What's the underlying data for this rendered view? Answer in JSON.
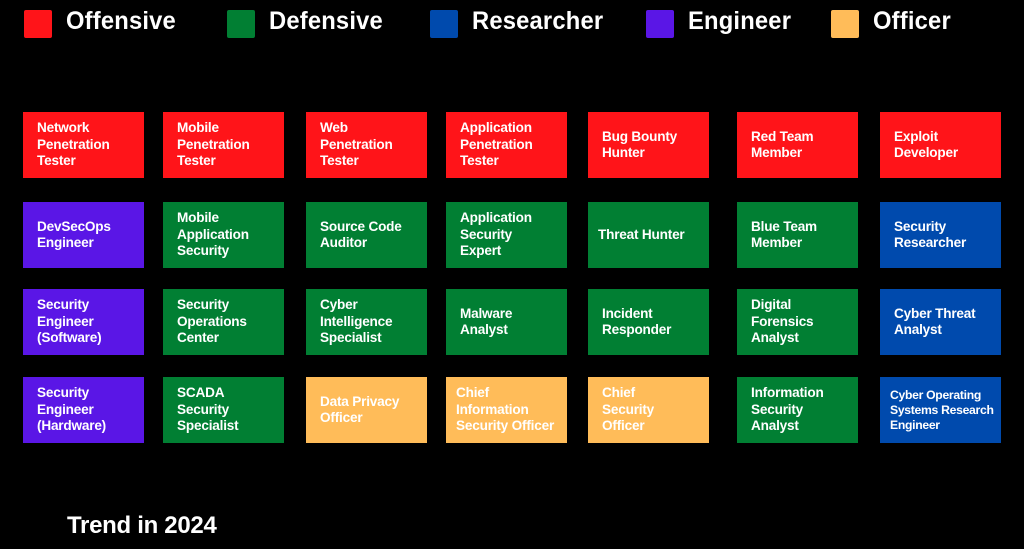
{
  "legend": [
    {
      "label": "Offensive",
      "color": "#ff1419"
    },
    {
      "label": "Defensive",
      "color": "#017f33"
    },
    {
      "label": "Researcher",
      "color": "#004aad"
    },
    {
      "label": "Engineer",
      "color": "#5a16e6"
    },
    {
      "label": "Officer",
      "color": "#ffbc59"
    }
  ],
  "colors": {
    "Offensive": "#ff1419",
    "Defensive": "#017f33",
    "Researcher": "#004aad",
    "Engineer": "#5a16e6",
    "Officer": "#ffbc59"
  },
  "rows": [
    [
      {
        "label": "Network\nPenetration\nTester",
        "category": "Offensive"
      },
      {
        "label": "Mobile\nPenetration\nTester",
        "category": "Offensive"
      },
      {
        "label": "Web\nPenetration\nTester",
        "category": "Offensive"
      },
      {
        "label": "Application\nPenetration\nTester",
        "category": "Offensive"
      },
      {
        "label": "Bug  Bounty\nHunter",
        "category": "Offensive"
      },
      {
        "label": "Red Team\nMember",
        "category": "Offensive"
      },
      {
        "label": "Exploit\nDeveloper",
        "category": "Offensive"
      }
    ],
    [
      {
        "label": "DevSecOps\nEngineer",
        "category": "Engineer"
      },
      {
        "label": "Mobile\nApplication\nSecurity",
        "category": "Defensive"
      },
      {
        "label": "Source Code\nAuditor",
        "category": "Defensive"
      },
      {
        "label": "Application\nSecurity\nExpert",
        "category": "Defensive"
      },
      {
        "label": "Threat Hunter",
        "category": "Defensive"
      },
      {
        "label": "Blue Team\nMember",
        "category": "Defensive"
      },
      {
        "label": "Security\nResearcher",
        "category": "Researcher"
      }
    ],
    [
      {
        "label": "Security\nEngineer\n(Software)",
        "category": "Engineer"
      },
      {
        "label": "Security\nOperations\nCenter",
        "category": "Defensive"
      },
      {
        "label": "Cyber\nIntelligence\nSpecialist",
        "category": "Defensive"
      },
      {
        "label": "Malware\nAnalyst",
        "category": "Defensive"
      },
      {
        "label": "Incident\nResponder",
        "category": "Defensive"
      },
      {
        "label": "Digital\nForensics\nAnalyst",
        "category": "Defensive"
      },
      {
        "label": "Cyber Threat\nAnalyst",
        "category": "Researcher"
      }
    ],
    [
      {
        "label": "Security\nEngineer\n(Hardware)",
        "category": "Engineer"
      },
      {
        "label": "SCADA\nSecurity\nSpecialist",
        "category": "Defensive"
      },
      {
        "label": "Data Privacy\nOfficer",
        "category": "Officer"
      },
      {
        "label": "Chief\nInformation\nSecurity Officer",
        "category": "Officer"
      },
      {
        "label": "Chief\nSecurity\nOfficer",
        "category": "Officer"
      },
      {
        "label": "Information\nSecurity\nAnalyst",
        "category": "Defensive"
      },
      {
        "label": "Cyber Operating\nSystems Research\nEngineer",
        "category": "Researcher"
      }
    ]
  ],
  "footer": {
    "title": "Trend in 2024"
  }
}
